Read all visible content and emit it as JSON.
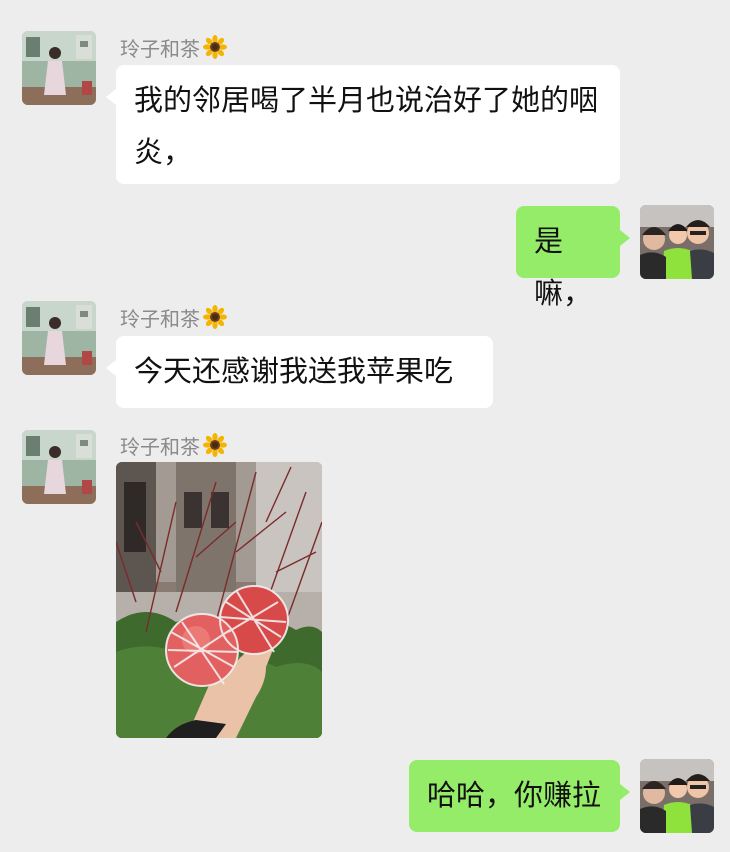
{
  "contact": {
    "name": "玲子和茶",
    "name_emoji": "sunflower-icon"
  },
  "messages": [
    {
      "from": "contact",
      "type": "text",
      "text": "我的邻居喝了半月也说治好了她的咽炎，"
    },
    {
      "from": "me",
      "type": "text",
      "text": "是嘛，"
    },
    {
      "from": "contact",
      "type": "text",
      "text": "今天还感谢我送我苹果吃"
    },
    {
      "from": "contact",
      "type": "image",
      "image": "photo-of-hand-holding-two-apples-in-foam-net"
    },
    {
      "from": "me",
      "type": "text",
      "text": "哈哈，你赚拉"
    }
  ],
  "colors": {
    "background": "#ededed",
    "incoming_bubble": "#ffffff",
    "outgoing_bubble": "#95ec69",
    "sender_name": "#8a8a8a"
  }
}
